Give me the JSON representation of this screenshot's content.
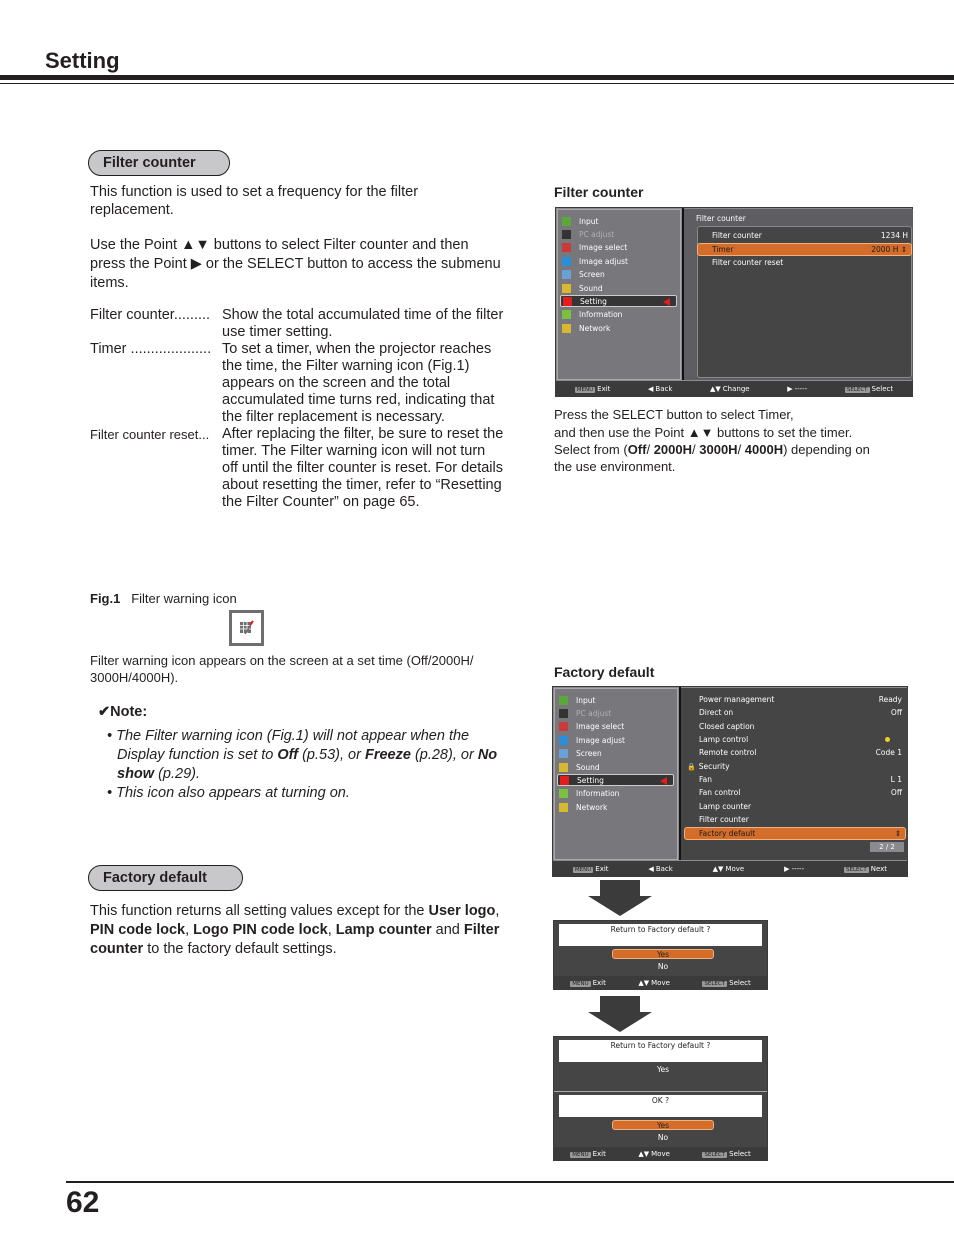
{
  "header": {
    "title": "Setting",
    "page_number": "62"
  },
  "filter_counter_section": {
    "heading": "Filter counter",
    "intro": "This function is used to set a frequency for the filter replacement.",
    "instruction_part1": "Use the Point ▲▼ buttons to select Filter counter and then press the Point ▶ or the SELECT button to access the submenu items.",
    "definitions": [
      {
        "term": "Filter counter.........",
        "desc": "Show the total accumulated time of the filter use timer setting."
      },
      {
        "term": "Timer ....................",
        "desc": "To set a timer, when the projector reaches the time, the Filter warning icon (Fig.1) appears on the screen and the total accumulated time turns red, indicating that the filter replacement is necessary."
      },
      {
        "term": "Filter counter reset...",
        "desc": "After replacing the filter, be sure to reset the timer. The Filter warning icon will not turn off until the filter counter is reset. For details about resetting the timer, refer to “Resetting the Filter Counter” on page 65."
      }
    ],
    "fig_label": "Fig.1",
    "fig_caption": "Filter warning icon",
    "fig_description": "Filter warning icon appears on the screen at a set time (Off/2000H/ 3000H/4000H).",
    "note_heading": "✔Note:",
    "note_items": [
      {
        "t1": "The Filter warning icon (Fig.1) will not appear when the Display function is set to ",
        "b1": "Off",
        "t2": " (p.53), or ",
        "b2": "Freeze",
        "t3": " (p.28), or ",
        "b3": "No show",
        "t4": " (p.29)."
      },
      {
        "t1": "This icon also appears at turning on."
      }
    ]
  },
  "filter_counter_screen": {
    "label": "Filter counter",
    "menu_items": [
      {
        "label": "Input",
        "icon": "input-icon",
        "disabled": false
      },
      {
        "label": "PC adjust",
        "icon": "pc-adjust-icon",
        "disabled": true
      },
      {
        "label": "Image select",
        "icon": "image-select-icon",
        "disabled": false
      },
      {
        "label": "Image adjust",
        "icon": "image-adjust-icon",
        "disabled": false
      },
      {
        "label": "Screen",
        "icon": "screen-icon",
        "disabled": false
      },
      {
        "label": "Sound",
        "icon": "sound-icon",
        "disabled": false
      },
      {
        "label": "Setting",
        "icon": "setting-icon",
        "disabled": false,
        "selected": true
      },
      {
        "label": "Information",
        "icon": "information-icon",
        "disabled": false
      },
      {
        "label": "Network",
        "icon": "network-icon",
        "disabled": false
      }
    ],
    "submenu_title": "Filter counter",
    "submenu_rows": [
      {
        "label": "Filter counter",
        "value": "1234 H"
      },
      {
        "label": "Timer",
        "value": "2000 H",
        "highlighted": true
      },
      {
        "label": "Filter counter reset",
        "value": ""
      }
    ],
    "footer": [
      {
        "key": "MENU",
        "label": "Exit"
      },
      {
        "key": "◀",
        "label": "Back"
      },
      {
        "key": "▲▼",
        "label": "Change"
      },
      {
        "key": "▶",
        "label": "-----"
      },
      {
        "key": "SELECT",
        "label": "Select"
      }
    ],
    "caption_line1": "Press the SELECT button to select  Timer,",
    "caption_line2": "and then use the Point ▲▼ buttons to set the timer. Select from (",
    "caption_options": [
      "Off",
      "2000H",
      "3000H",
      "4000H"
    ],
    "caption_end": ") depending on the use environment."
  },
  "factory_default_section": {
    "heading": "Factory default",
    "text_a": "This function returns all setting values except for the ",
    "bold_1": "User logo",
    "bold_2": "PIN code lock",
    "bold_3": "Logo PIN code lock",
    "bold_4": "Lamp counter",
    "text_and": " and ",
    "bold_5": "Filter counter",
    "text_end": " to the factory default settings."
  },
  "factory_default_screen": {
    "label": "Factory default",
    "submenu_rows": [
      {
        "label": "Power management",
        "value": "Ready"
      },
      {
        "label": "Direct on",
        "value": "Off"
      },
      {
        "label": "Closed caption",
        "value": ""
      },
      {
        "label": "Lamp control",
        "value": "lamp-icon"
      },
      {
        "label": "Remote control",
        "value": "Code 1"
      },
      {
        "label": "Security",
        "value": "",
        "icon": "lock-icon"
      },
      {
        "label": "Fan",
        "value": "L 1"
      },
      {
        "label": "Fan control",
        "value": "Off"
      },
      {
        "label": "Lamp counter",
        "value": ""
      },
      {
        "label": "Filter counter",
        "value": ""
      },
      {
        "label": "Factory default",
        "value": "",
        "highlighted": true
      }
    ],
    "page_indicator": "2 / 2",
    "footer": [
      {
        "key": "MENU",
        "label": "Exit"
      },
      {
        "key": "◀",
        "label": "Back"
      },
      {
        "key": "▲▼",
        "label": "Move"
      },
      {
        "key": "▶",
        "label": "-----"
      },
      {
        "key": "SELECT",
        "label": "Next"
      }
    ]
  },
  "dialog1": {
    "question": "Return to Factory default ?",
    "yes": "Yes",
    "no": "No",
    "footer": [
      {
        "key": "MENU",
        "label": "Exit"
      },
      {
        "key": "▲▼",
        "label": "Move"
      },
      {
        "key": "SELECT",
        "label": "Select"
      }
    ]
  },
  "dialog2": {
    "question": "Return to Factory default ?",
    "answer": "Yes",
    "confirm": "OK ?",
    "yes": "Yes",
    "no": "No",
    "footer": [
      {
        "key": "MENU",
        "label": "Exit"
      },
      {
        "key": "▲▼",
        "label": "Move"
      },
      {
        "key": "SELECT",
        "label": "Select"
      }
    ]
  },
  "colors": {
    "highlight": "#d46d2a",
    "pill": "#c8c8ca",
    "selector_arrow": "#e21d1d"
  }
}
